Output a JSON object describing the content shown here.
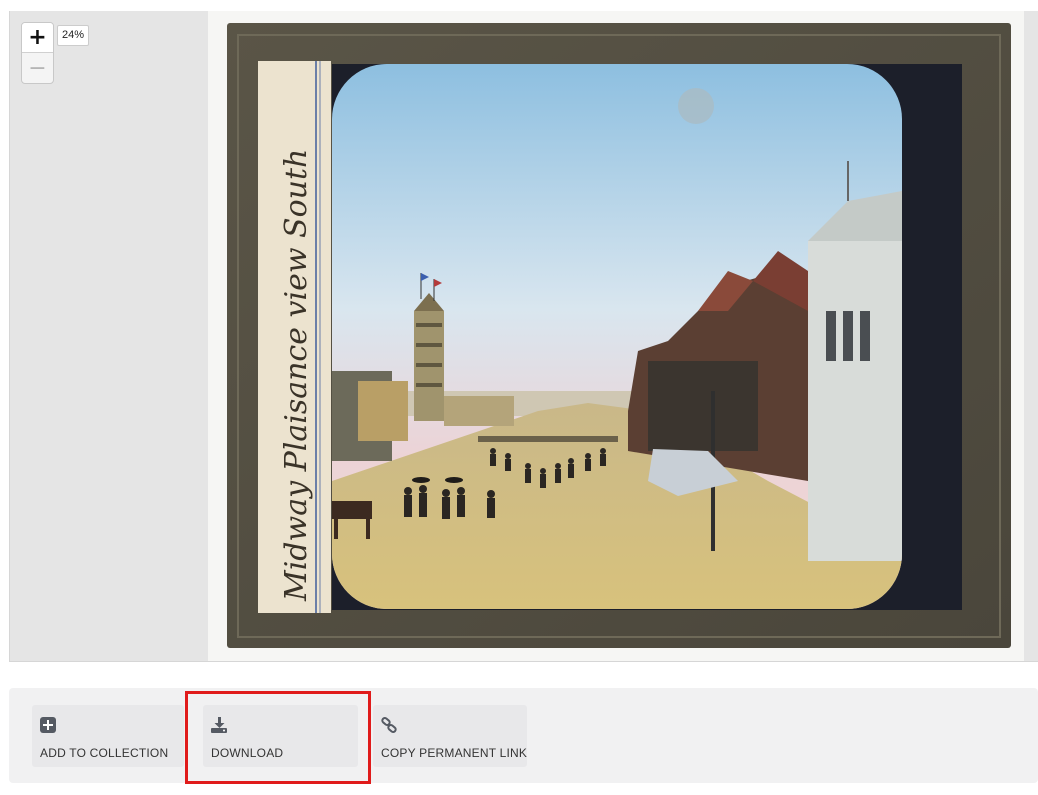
{
  "viewer": {
    "zoom_in_label": "+",
    "zoom_out_label": "−",
    "zoom_level": "24%",
    "slide_caption": "Midway Plaisance view South"
  },
  "toolbar": {
    "add_to_collection_label": "ADD TO COLLECTION",
    "download_label": "DOWNLOAD",
    "copy_link_label": "COPY PERMANENT LINK"
  },
  "colors": {
    "highlight": "#e01b1b",
    "toolbar_bg": "#f1f1f2",
    "button_bg": "#e8e8ea",
    "viewer_bg": "#e5e5e5",
    "icon": "#555a63"
  },
  "icons": {
    "add": "plus-square-icon",
    "download": "download-icon",
    "link": "link-icon"
  }
}
